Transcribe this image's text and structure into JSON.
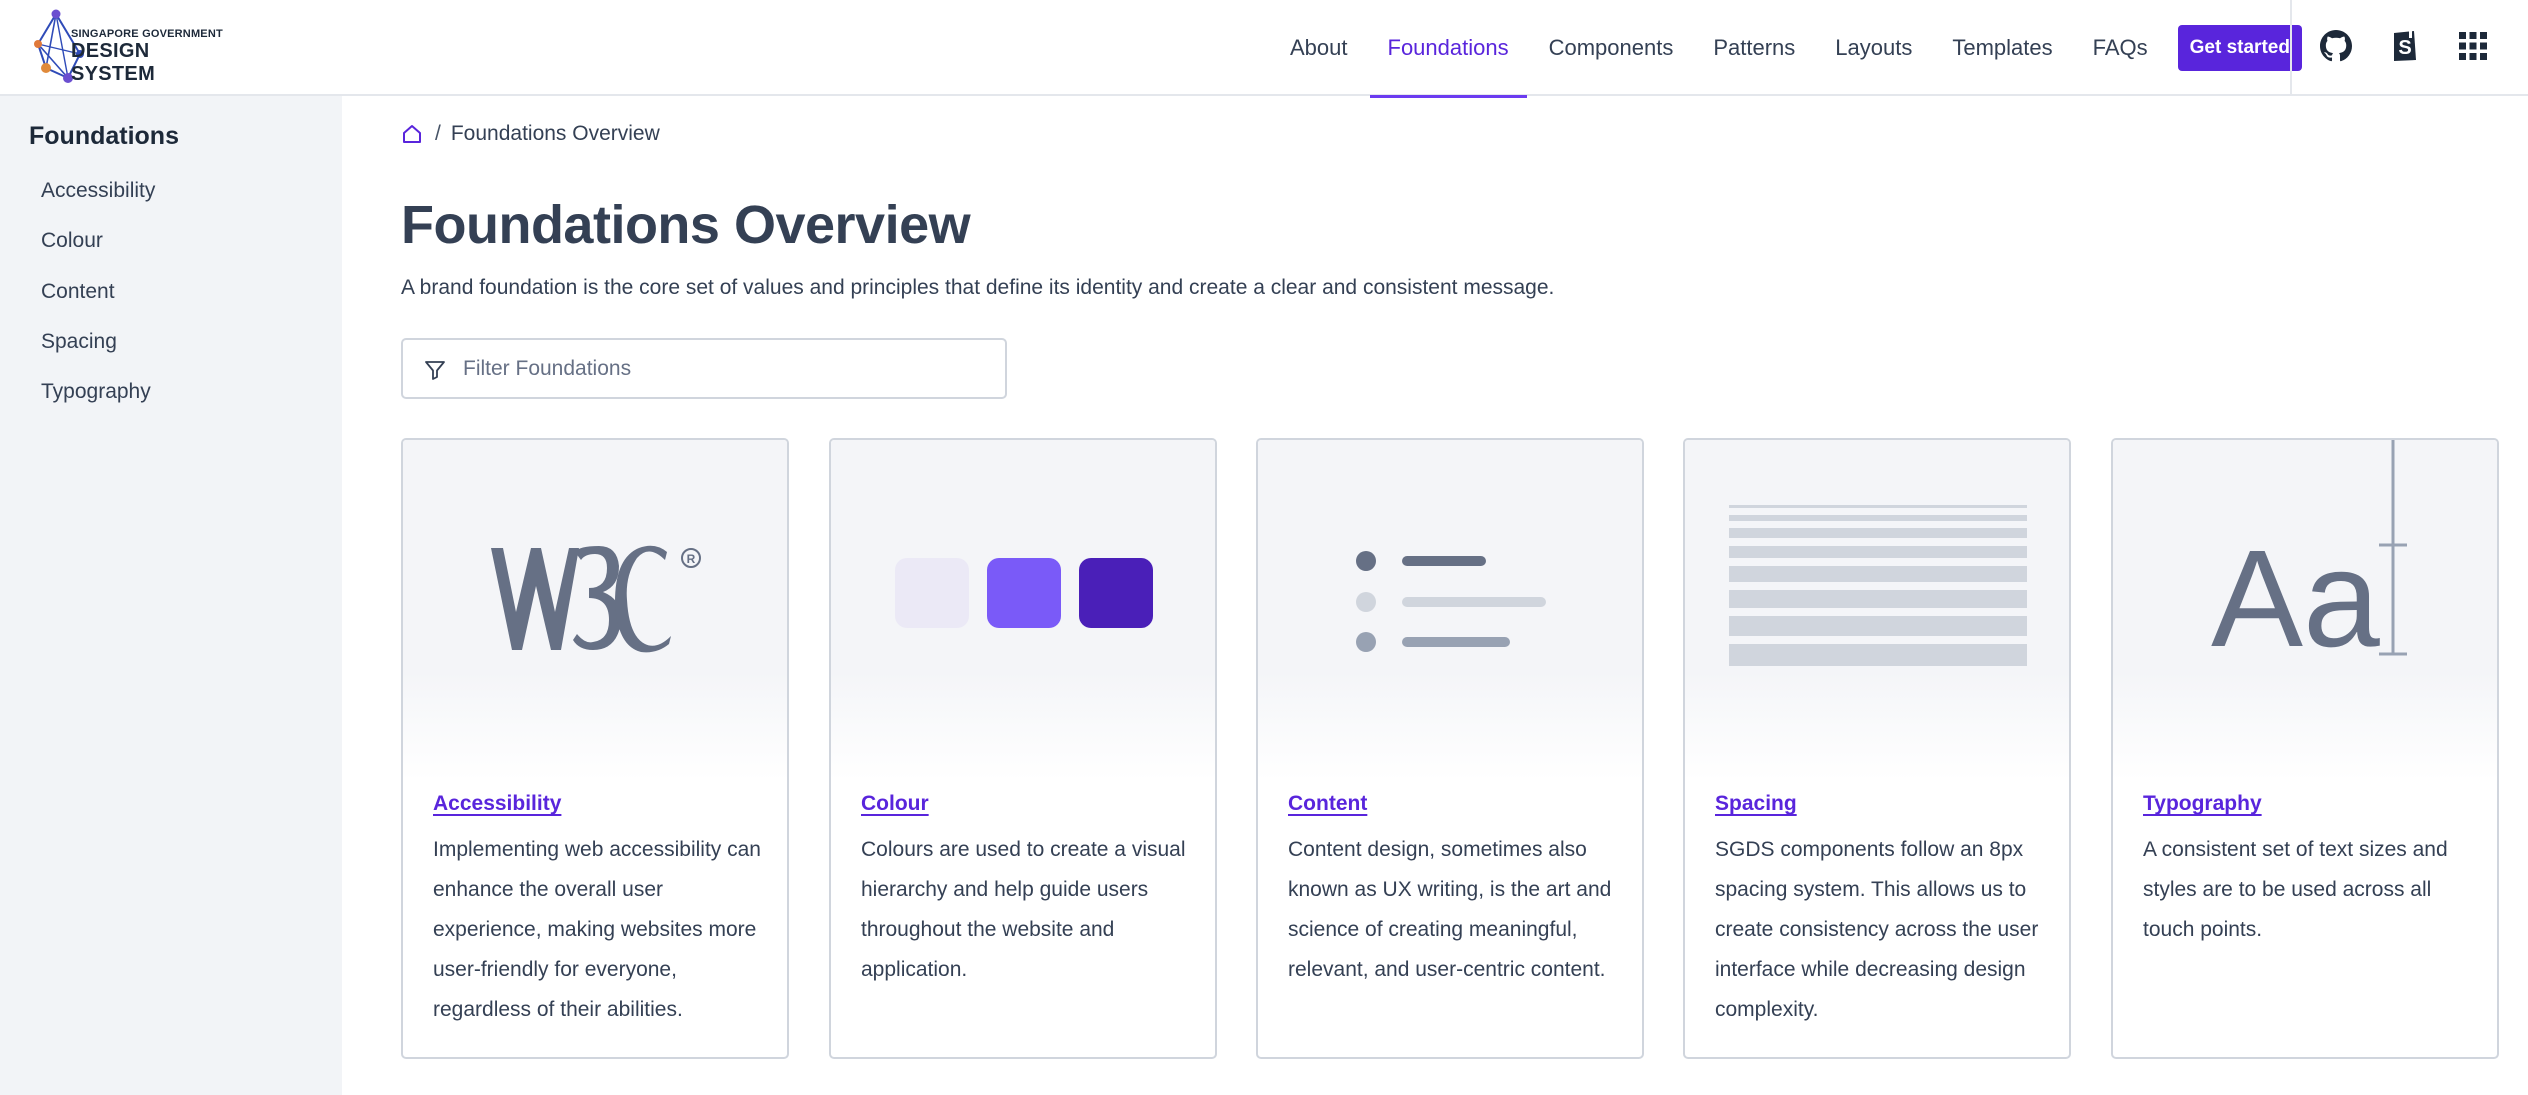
{
  "header": {
    "logo": {
      "line1": "SINGAPORE GOVERNMENT",
      "line2": "DESIGN SYSTEM"
    },
    "nav": [
      {
        "label": "About",
        "active": false
      },
      {
        "label": "Foundations",
        "active": true
      },
      {
        "label": "Components",
        "active": false
      },
      {
        "label": "Patterns",
        "active": false
      },
      {
        "label": "Layouts",
        "active": false
      },
      {
        "label": "Templates",
        "active": false
      },
      {
        "label": "FAQs",
        "active": false
      }
    ],
    "cta_label": "Get started",
    "icons": [
      "github-icon",
      "storybook-icon",
      "apps-grid-icon"
    ]
  },
  "sidebar": {
    "title": "Foundations",
    "items": [
      "Accessibility",
      "Colour",
      "Content",
      "Spacing",
      "Typography"
    ]
  },
  "breadcrumb": {
    "separator": "/",
    "current": "Foundations Overview"
  },
  "main": {
    "title": "Foundations Overview",
    "description": "A brand foundation is the core set of values and principles that define its identity and create a clear and consistent message.",
    "filter_placeholder": "Filter Foundations"
  },
  "cards": [
    {
      "title": "Accessibility",
      "description": "Implementing web accessibility can enhance the overall user experience, making websites more user-friendly for everyone, regardless of their abilities.",
      "visual": "w3c-logo"
    },
    {
      "title": "Colour",
      "description": "Colours are used to create a visual hierarchy and help guide users throughout the website and application.",
      "visual": "colour-swatches"
    },
    {
      "title": "Content",
      "description": "Content design, sometimes also known as UX writing, is the art and science of creating meaningful, relevant, and user-centric content.",
      "visual": "content-list"
    },
    {
      "title": "Spacing",
      "description": "SGDS components follow an 8px spacing system. This allows us to create consistency across the user interface while decreasing design complexity.",
      "visual": "spacing-bars"
    },
    {
      "title": "Typography",
      "description": "A consistent set of text sizes and styles are to be used across all touch points.",
      "visual": "typography-sample",
      "sample_text": "Aa"
    }
  ],
  "colors": {
    "accent": "#5925dc",
    "swatch_light": "#ebe9f6",
    "swatch_mid": "#7a5af8",
    "swatch_dark": "#4a1fb8",
    "text": "#344054",
    "sidebar_bg": "#f2f4f7"
  }
}
